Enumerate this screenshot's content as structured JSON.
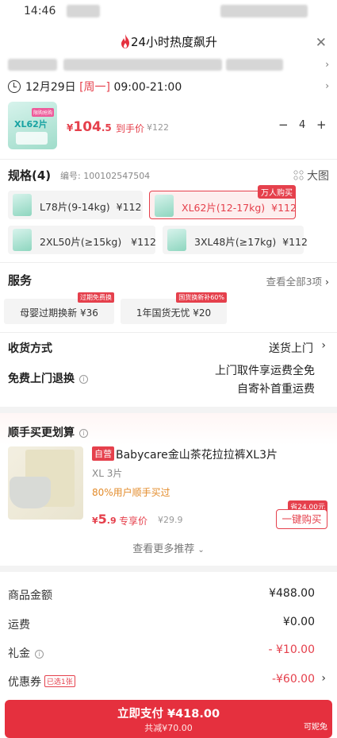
{
  "status_bar": {
    "time": "14:46"
  },
  "header": {
    "title": "24小时热度飙升"
  },
  "delivery": {
    "date": "12月29日",
    "weekday": "[周一]",
    "time_range": "09:00-21:00"
  },
  "product": {
    "thumb_tag": "限购抢购",
    "thumb_text": "XL62片",
    "price_symbol": "¥",
    "price_int": "104",
    "price_dec": ".5",
    "price_label": "到手价",
    "price_old": "¥122",
    "quantity": "4",
    "minus": "−",
    "plus": "+"
  },
  "spec": {
    "title": "规格(4)",
    "code": "编号: 100102547504",
    "big_pic": "大图",
    "options": [
      {
        "label": "L78片(9-14kg)",
        "price": "¥112"
      },
      {
        "label": "XL62片(12-17kg)",
        "price": "¥112",
        "badge": "万人购买"
      },
      {
        "label": "2XL50片(≥15kg)",
        "price": "¥112"
      },
      {
        "label": "3XL48片(≥17kg)",
        "price": "¥112"
      }
    ]
  },
  "service": {
    "title": "服务",
    "view_all": "查看全部3项",
    "cards": [
      {
        "label": "母婴过期换新 ¥36",
        "badge": "过期免费换"
      },
      {
        "label": "1年国货无忧 ¥20",
        "badge": "国货换新补60%"
      }
    ]
  },
  "shipping": {
    "label": "收货方式",
    "value": "送货上门"
  },
  "return": {
    "label": "免费上门退换",
    "line1": "上门取件享运费全免",
    "line2": "自寄补首重运费"
  },
  "bundle": {
    "title": "顺手买更划算",
    "self_tag": "自营",
    "name": "Babycare金山茶花拉拉裤XL3片",
    "spec": "XL  3片",
    "stat": "80%用户顺手买过",
    "price_symbol": "¥",
    "price_int": "5",
    "price_dec": ".9",
    "price_label": "专享价",
    "price_old": "¥29.9",
    "save_tag": "省24.00元",
    "buy_button": "一键购买",
    "more": "查看更多推荐"
  },
  "summary": {
    "items": [
      {
        "label": "商品金额",
        "value": "¥488.00"
      },
      {
        "label": "运费",
        "value": "¥0.00"
      },
      {
        "label": "礼金",
        "value": "- ¥10.00"
      },
      {
        "label": "优惠券",
        "badge": "已选1张",
        "value": "-¥60.00"
      }
    ]
  },
  "pay": {
    "main": "立即支付 ¥418.00",
    "sub": "共减¥70.00",
    "right": "可妮兔"
  },
  "colors": {
    "accent": "#e5404c",
    "pay_button": "#e5303e"
  }
}
